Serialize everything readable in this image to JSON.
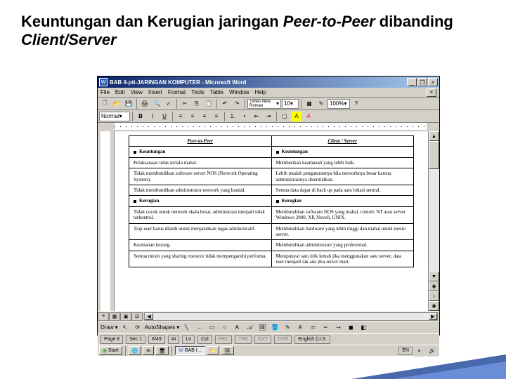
{
  "slide": {
    "title_prefix": "Keuntungan dan Kerugian jaringan ",
    "title_italic1": "Peer-to-Peer",
    "title_join": " dibanding ",
    "title_italic2": "Client/Server"
  },
  "window": {
    "title": "BAB II-pti-JARINGAN KOMPUTER - Microsoft Word",
    "controls": {
      "min": "_",
      "max": "❐",
      "close": "×",
      "inner_close": "×"
    }
  },
  "menu": [
    "File",
    "Edit",
    "View",
    "Insert",
    "Format",
    "Tools",
    "Table",
    "Window",
    "Help"
  ],
  "toolbar1": {
    "style_combo": "100%",
    "icons": [
      "new",
      "open",
      "save",
      "mail",
      "print",
      "preview",
      "spell",
      "cut",
      "copy",
      "paste",
      "undo",
      "redo",
      "link",
      "tables",
      "excel",
      "columns",
      "drawing",
      "map",
      "para",
      "zoom",
      "help"
    ]
  },
  "toolbar2": {
    "font_name": "Times New Roman",
    "font_size": "10",
    "style": "Normal",
    "icons": [
      "bold",
      "italic",
      "underline",
      "left",
      "center",
      "right",
      "justify",
      "numlist",
      "bullist",
      "outdent",
      "indent",
      "border",
      "highlight",
      "fontcolor"
    ]
  },
  "table": {
    "headers": [
      "Peer-to-Peer",
      "Client / Server"
    ],
    "section1": [
      "Keuntungan",
      "Keuntungan"
    ],
    "rows1": [
      [
        "Pelaksanaan tidak terlalu mahal.",
        "Memberikan keamanan yang lebih baik."
      ],
      [
        "Tidak membutuhkan software server NOS (Network Operating System).",
        "Lebih mudah pengaturannya bila networknya besar karena administrasinya disentralkan."
      ],
      [
        "Tidak membutuhkan administrator network yang handal.",
        "Semua data dapat di back up pada satu lokasi sentral."
      ]
    ],
    "section2": [
      "Kerugian",
      "Kerugian"
    ],
    "rows2": [
      [
        "Tidak cocok untuk network skala besar, administrasi menjadi tidak terkontrol.",
        "Membutuhkan software NOS yang mahal, contoh: NT atau server Windows 2000, XP, Novell, UNIX."
      ],
      [
        "Tiap user harus dilatih untuk menjalankan tugas administratif.",
        "Membutuhkan hardware yang lebih tinggi dan mahal untuk mesin server."
      ],
      [
        "Keamanan kurang.",
        "Membutuhkan administrator yang profesional."
      ],
      [
        "Semua mesin yang sharing resource tidak mempengaruhi performa.",
        "Mempunyai satu titik lemah jika menggunakan satu server, data user menjadi tak ada jika server mati."
      ]
    ]
  },
  "drawbar": {
    "draw_label": "Draw",
    "autoshapes": "AutoShapes"
  },
  "status": {
    "page": "Page 8",
    "sec": "Sec 1",
    "pages": "8/49",
    "at": "At",
    "ln": "Ln",
    "col": "Col",
    "rec": "REC",
    "trk": "TRK",
    "ext": "EXT",
    "ovr": "OVR",
    "lang": "English (U.S."
  },
  "taskbar": {
    "start": "Start",
    "items": [
      "",
      "",
      "",
      "BAB I...",
      "",
      ""
    ],
    "tray": [
      "EN",
      "◐",
      "🔊"
    ],
    "time": ""
  }
}
